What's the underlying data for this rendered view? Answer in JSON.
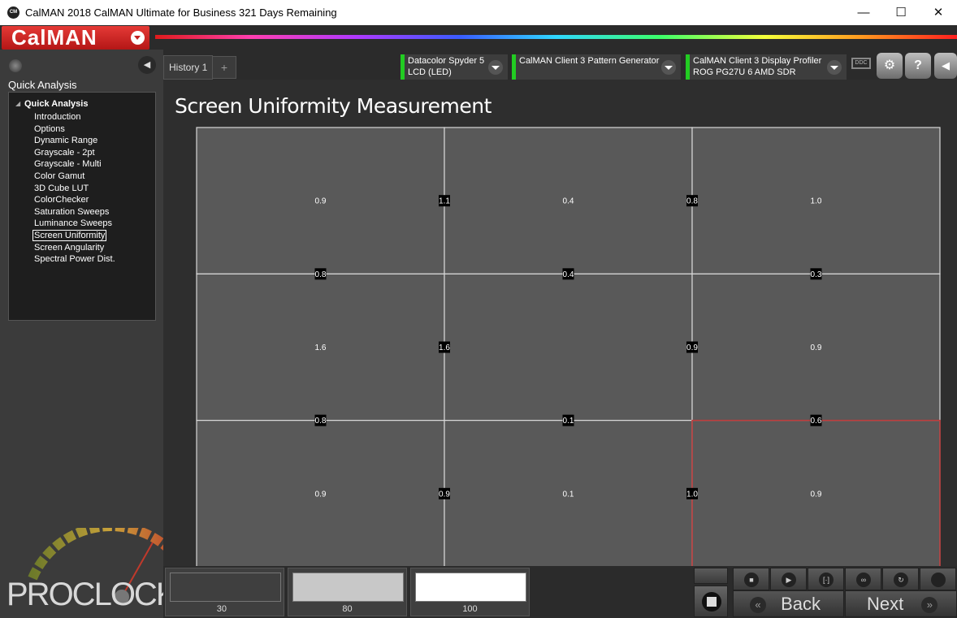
{
  "window": {
    "title": "CalMAN 2018 CalMAN Ultimate for Business 321 Days Remaining",
    "icon_label": "CM",
    "minimize": "—",
    "maximize": "☐",
    "close": "✕"
  },
  "brand": {
    "logo": "CalMAN"
  },
  "left_panel": {
    "title": "Quick Analysis",
    "tree_root": "Quick Analysis",
    "items": [
      "Introduction",
      "Options",
      "Dynamic Range",
      "Grayscale - 2pt",
      "Grayscale - Multi",
      "Color Gamut",
      "3D Cube LUT",
      "ColorChecker",
      "Saturation Sweeps",
      "Luminance Sweeps",
      "Screen Uniformity",
      "Screen Angularity",
      "Spectral Power Dist."
    ],
    "selected_index": 10
  },
  "toolbar": {
    "history_tab": "History 1",
    "add_tab": "+",
    "devices": [
      {
        "line1": "Datacolor Spyder 5",
        "line2": "LCD (LED)"
      },
      {
        "line1": "CalMAN Client 3 Pattern Generator",
        "line2": ""
      },
      {
        "line1": "CalMAN Client 3 Display Profiler",
        "line2": "ROG PG27U 6 AMD SDR"
      }
    ],
    "ddc_label": "DDC",
    "help_label": "?",
    "settings_label": "⚙",
    "back_arrow": "◀"
  },
  "main": {
    "title": "Screen Uniformity Measurement",
    "cells": [
      "0.9",
      "0.4",
      "1.0",
      "1.6",
      "",
      "0.9",
      "0.9",
      "0.1",
      "0.9"
    ],
    "vertical_edges": [
      "1.1",
      "0.8",
      "1.6",
      "0.9",
      "0.9",
      "1.0"
    ],
    "horizontal_edges": [
      "0.8",
      "0.4",
      "0.3",
      "0.8",
      "0.1",
      "0.6"
    ],
    "highlight_color": "#c03a3a"
  },
  "bottom": {
    "patches": [
      {
        "label": "30",
        "color": "#3f3f3f"
      },
      {
        "label": "80",
        "color": "#c8c8c8"
      },
      {
        "label": "100",
        "color": "#ffffff"
      }
    ],
    "back_label": "Back",
    "next_label": "Next"
  },
  "watermark": {
    "text": "PROCLOCKERS"
  }
}
